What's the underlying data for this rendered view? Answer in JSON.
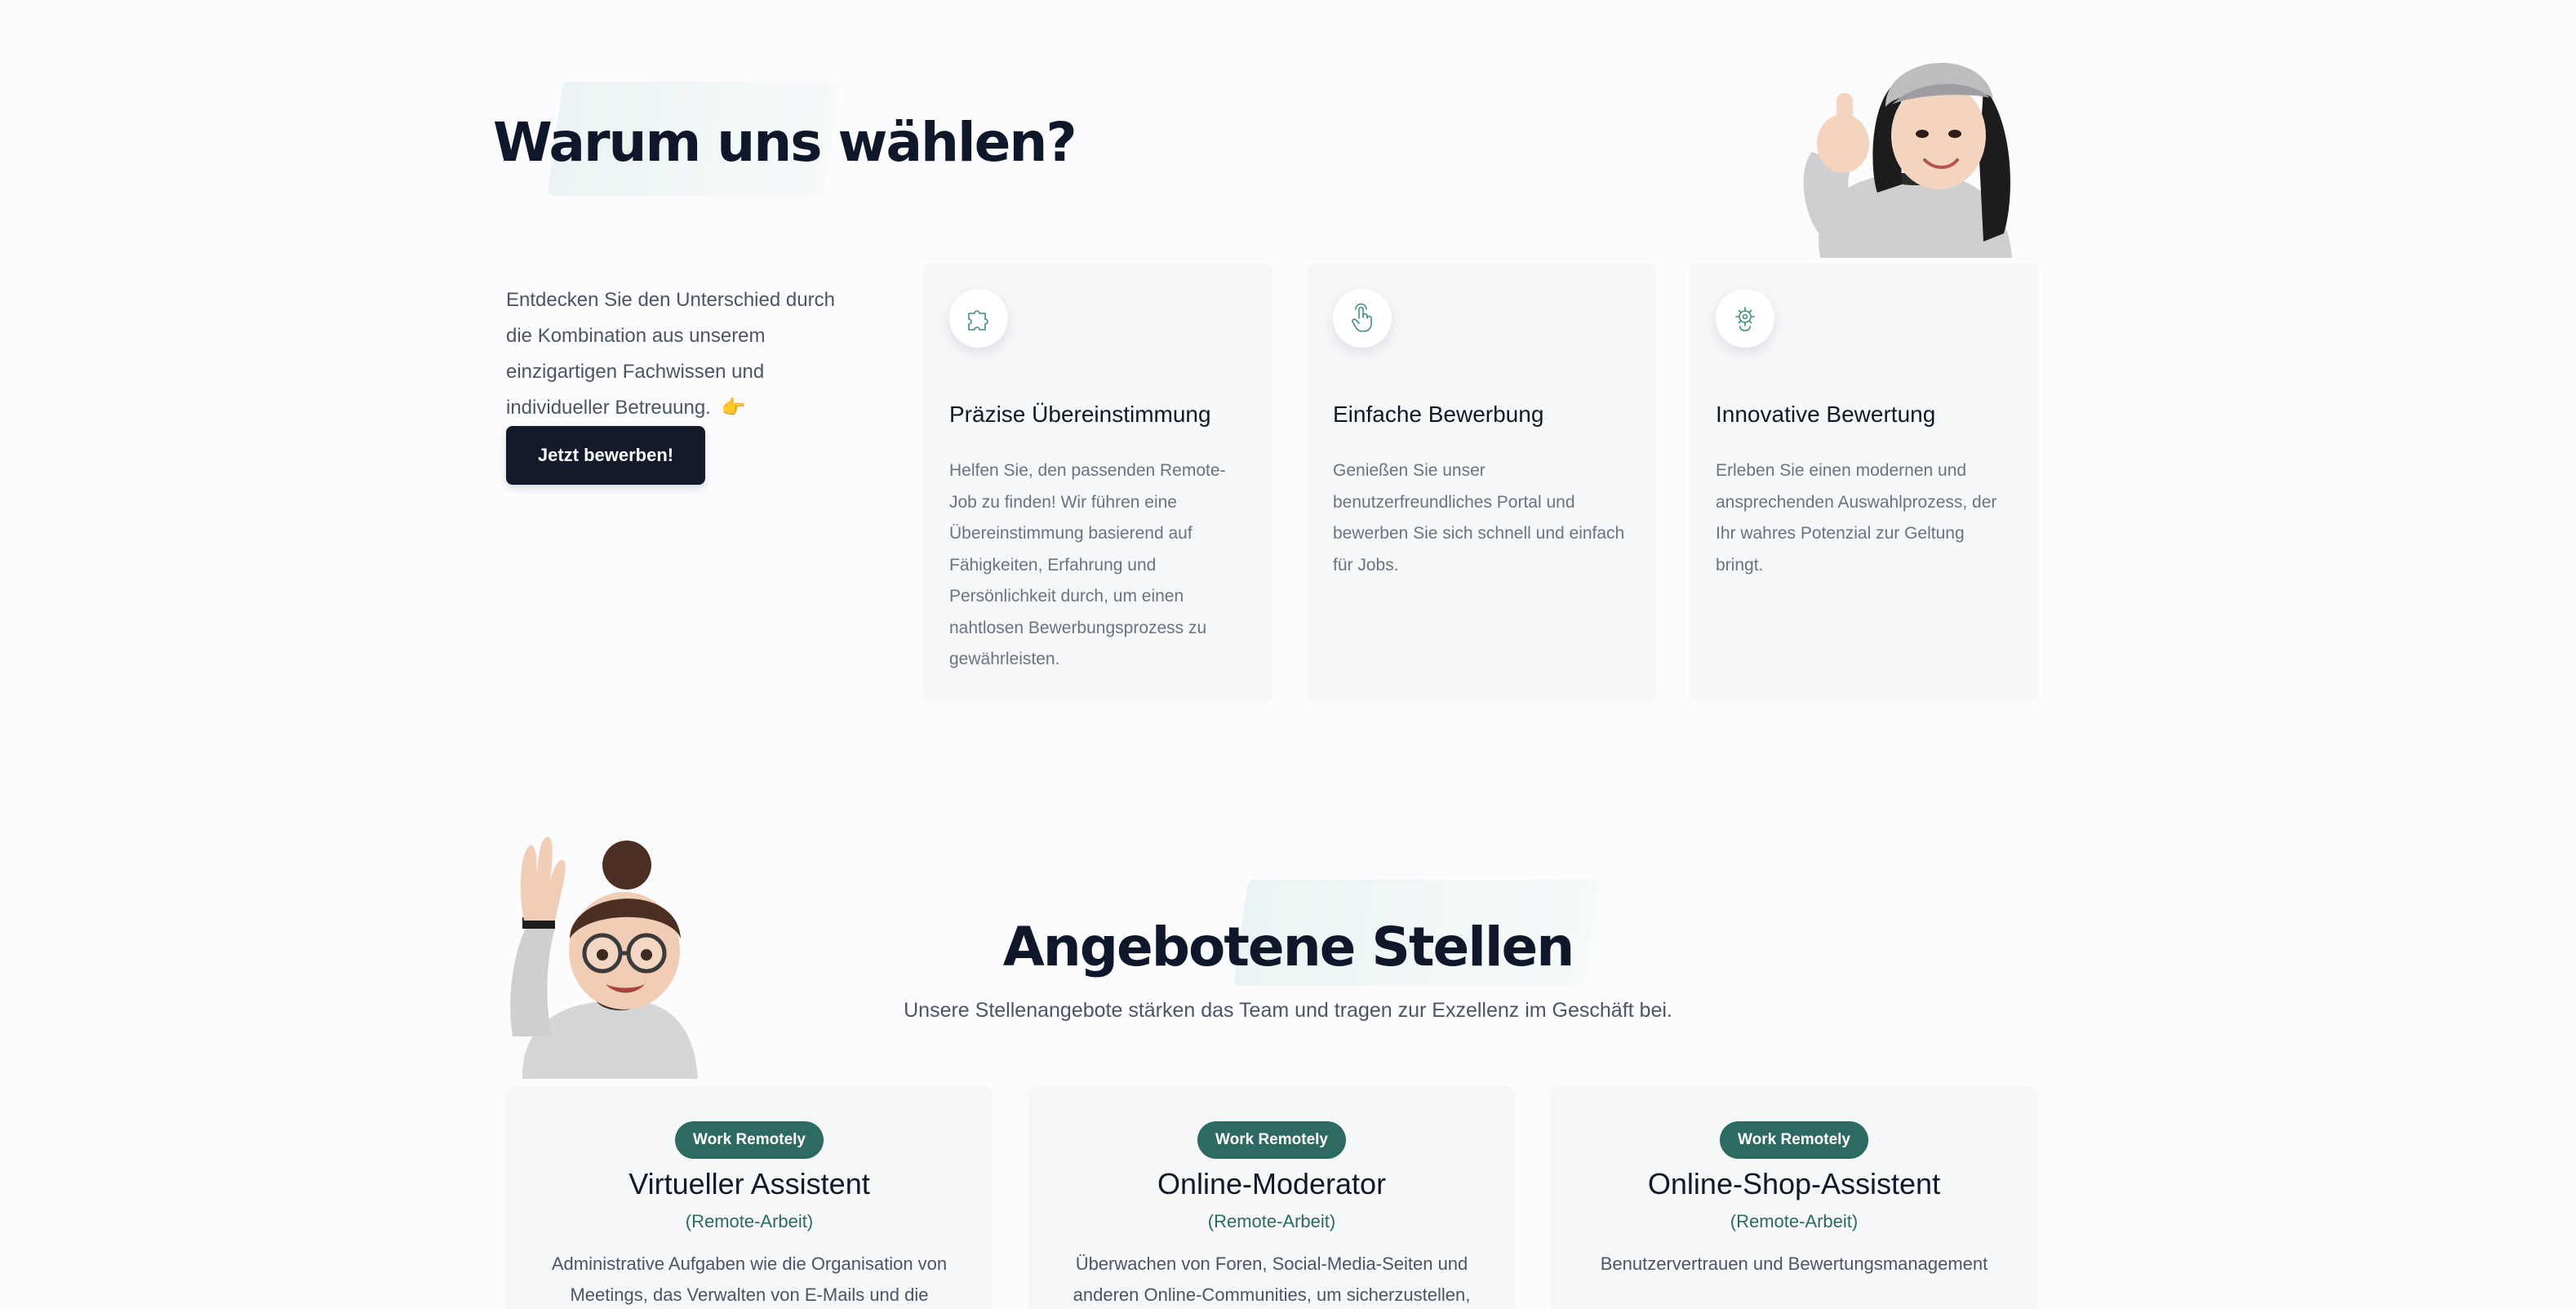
{
  "why": {
    "title": "Warum uns wählen?",
    "intro": "Entdecken Sie den Unterschied durch die Kombination aus unserem einzigartigen Fachwissen und individueller Betreuung.",
    "intro_emoji": "👉",
    "cta_label": "Jetzt bewerben!",
    "features": [
      {
        "icon": "puzzle-icon",
        "title": "Präzise Übereinstimmung",
        "description": "Helfen Sie, den passenden Remote-Job zu finden! Wir führen eine Übereinstimmung basierend auf Fähigkeiten, Erfahrung und Persönlichkeit durch, um einen nahtlosen Bewerbungsprozess zu gewährleisten."
      },
      {
        "icon": "hand-pointer-icon",
        "title": "Einfache Bewerbung",
        "description": "Genießen Sie unser benutzerfreundliches Portal und bewerben Sie sich schnell und einfach für Jobs."
      },
      {
        "icon": "gear-brain-icon",
        "title": "Innovative Bewertung",
        "description": "Erleben Sie einen modernen und ansprechenden Auswahlprozess, der Ihr wahres Potenzial zur Geltung bringt."
      }
    ]
  },
  "jobs": {
    "title": "Angebotene Stellen",
    "subtitle": "Unsere Stellenangebote stärken das Team und tragen zur Exzellenz im Geschäft bei.",
    "items": [
      {
        "badge": "Work Remotely",
        "title": "Virtueller Assistent",
        "subtitle": "(Remote-Arbeit)",
        "description": "Administrative Aufgaben wie die Organisation von Meetings, das Verwalten von E-Mails und die"
      },
      {
        "badge": "Work Remotely",
        "title": "Online-Moderator",
        "subtitle": "(Remote-Arbeit)",
        "description": "Überwachen von Foren, Social-Media-Seiten und anderen Online-Communities, um sicherzustellen,"
      },
      {
        "badge": "Work Remotely",
        "title": "Online-Shop-Assistent",
        "subtitle": "(Remote-Arbeit)",
        "description": "Benutzervertrauen und Bewertungsmanagement"
      }
    ]
  },
  "colors": {
    "primary_dark": "#121a2c",
    "accent_teal": "#2c6a62",
    "card_bg": "#f6f7f9",
    "page_bg": "#fcfcfe"
  }
}
